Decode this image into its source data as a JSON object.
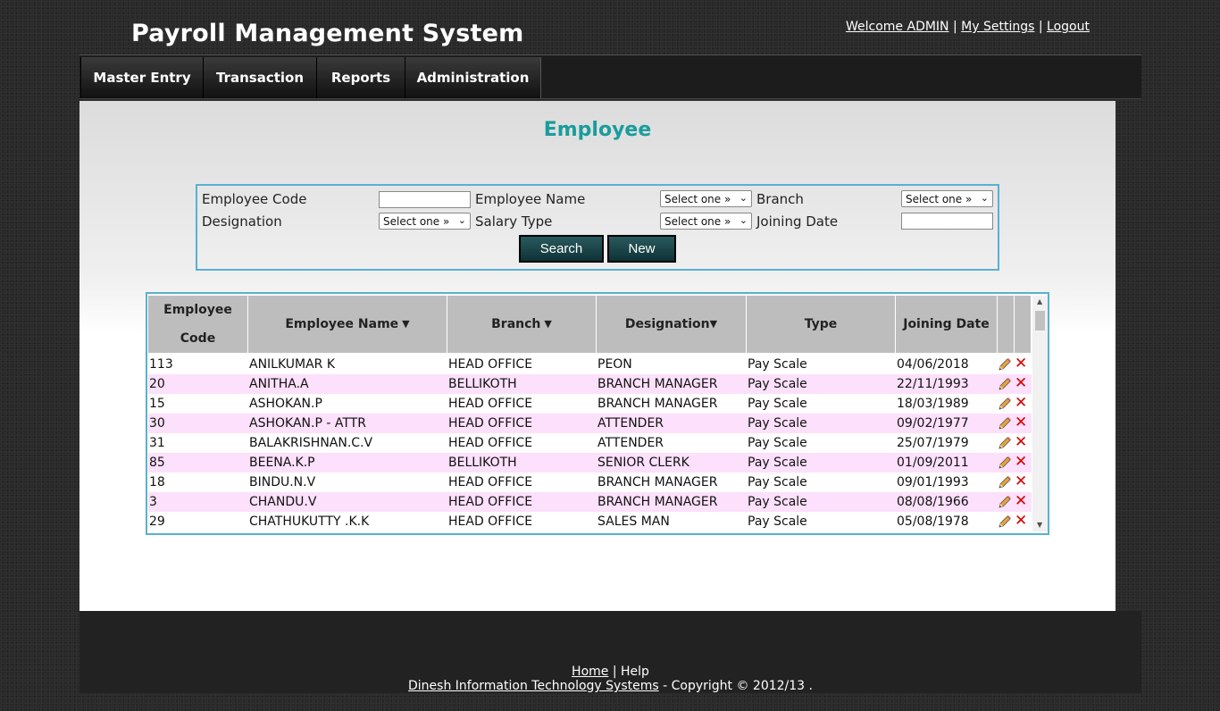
{
  "header": {
    "app_title": "Payroll Management System",
    "welcome": "Welcome ADMIN",
    "sep": "|",
    "my_settings": "My Settings",
    "logout": "Logout"
  },
  "nav": {
    "items": [
      "Master Entry",
      "Transaction",
      "Reports",
      "Administration"
    ]
  },
  "page": {
    "title": "Employee"
  },
  "filters": {
    "employee_code_label": "Employee Code",
    "employee_code_value": "",
    "employee_name_label": "Employee Name",
    "employee_name_select": "Select one »",
    "branch_label": "Branch",
    "branch_select": "Select one »",
    "designation_label": "Designation",
    "designation_select": "Select one »",
    "salary_type_label": "Salary Type",
    "salary_type_select": "Select one »",
    "joining_date_label": "Joining Date",
    "joining_date_value": "",
    "search_label": "Search",
    "new_label": "New"
  },
  "table": {
    "headers": {
      "code_line1": "Employee",
      "code_line2": "Code",
      "name": "Employee Name",
      "branch": "Branch",
      "designation": "Designation",
      "type": "Type",
      "joining_date": "Joining Date"
    },
    "rows": [
      {
        "code": "113",
        "name": "ANILKUMAR K",
        "branch": "HEAD OFFICE",
        "designation": "PEON",
        "type": "Pay Scale",
        "date": "04/06/2018"
      },
      {
        "code": "20",
        "name": "ANITHA.A",
        "branch": "BELLIKOTH",
        "designation": "BRANCH MANAGER",
        "type": "Pay Scale",
        "date": "22/11/1993"
      },
      {
        "code": "15",
        "name": "ASHOKAN.P",
        "branch": "HEAD OFFICE",
        "designation": "BRANCH MANAGER",
        "type": "Pay Scale",
        "date": "18/03/1989"
      },
      {
        "code": "30",
        "name": "ASHOKAN.P - ATTR",
        "branch": "HEAD OFFICE",
        "designation": "ATTENDER",
        "type": "Pay Scale",
        "date": "09/02/1977"
      },
      {
        "code": "31",
        "name": "BALAKRISHNAN.C.V",
        "branch": "HEAD OFFICE",
        "designation": "ATTENDER",
        "type": "Pay Scale",
        "date": "25/07/1979"
      },
      {
        "code": "85",
        "name": "BEENA.K.P",
        "branch": "BELLIKOTH",
        "designation": "SENIOR CLERK",
        "type": "Pay Scale",
        "date": "01/09/2011"
      },
      {
        "code": "18",
        "name": "BINDU.N.V",
        "branch": "HEAD OFFICE",
        "designation": "BRANCH MANAGER",
        "type": "Pay Scale",
        "date": "09/01/1993"
      },
      {
        "code": "3",
        "name": "CHANDU.V",
        "branch": "HEAD OFFICE",
        "designation": "BRANCH MANAGER",
        "type": "Pay Scale",
        "date": "08/08/1966"
      },
      {
        "code": "29",
        "name": "CHATHUKUTTY .K.K",
        "branch": "HEAD OFFICE",
        "designation": "SALES MAN",
        "type": "Pay Scale",
        "date": "05/08/1978"
      }
    ]
  },
  "footer": {
    "home": "Home",
    "sep": "|",
    "help": "Help",
    "company": "Dinesh Information Technology Systems",
    "copyright": "- Copyright © 2012/13 ."
  },
  "colors": {
    "accent_title": "#1a9c9c",
    "border_blue": "#5ab0d0",
    "row_alt": "#fde0fb",
    "delete_red": "#d40000"
  }
}
